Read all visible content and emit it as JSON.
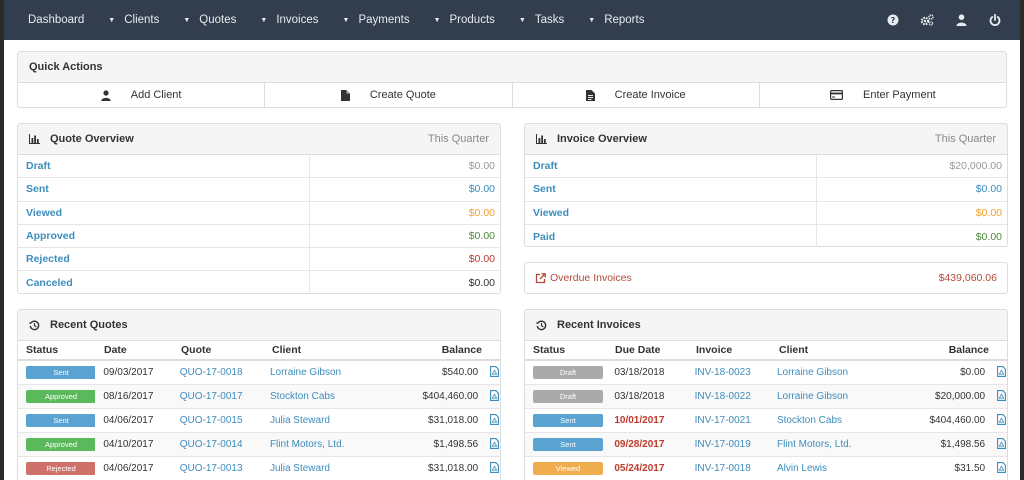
{
  "nav": {
    "items": [
      {
        "label": "Dashboard",
        "dropdown": false
      },
      {
        "label": "Clients",
        "dropdown": true
      },
      {
        "label": "Quotes",
        "dropdown": true
      },
      {
        "label": "Invoices",
        "dropdown": true
      },
      {
        "label": "Payments",
        "dropdown": true
      },
      {
        "label": "Products",
        "dropdown": true
      },
      {
        "label": "Tasks",
        "dropdown": true
      },
      {
        "label": "Reports",
        "dropdown": true
      }
    ],
    "right_icons": [
      "question-icon",
      "cogs-icon",
      "user-icon",
      "power-icon"
    ]
  },
  "quick_actions": {
    "title": "Quick Actions",
    "buttons": [
      {
        "label": "Add Client",
        "icon": "user-icon"
      },
      {
        "label": "Create Quote",
        "icon": "file-icon"
      },
      {
        "label": "Create Invoice",
        "icon": "file-text-icon"
      },
      {
        "label": "Enter Payment",
        "icon": "credit-card-icon"
      }
    ]
  },
  "quote_overview": {
    "title": "Quote Overview",
    "period": "This Quarter",
    "rows": [
      {
        "label": "Draft",
        "value": "$0.00",
        "color": "#999999"
      },
      {
        "label": "Sent",
        "value": "$0.00",
        "color": "#3c8dbc"
      },
      {
        "label": "Viewed",
        "value": "$0.00",
        "color": "#f0a030"
      },
      {
        "label": "Approved",
        "value": "$0.00",
        "color": "#4c8a3a"
      },
      {
        "label": "Rejected",
        "value": "$0.00",
        "color": "#c0392b"
      },
      {
        "label": "Canceled",
        "value": "$0.00",
        "color": "#333333"
      }
    ]
  },
  "invoice_overview": {
    "title": "Invoice Overview",
    "period": "This Quarter",
    "rows": [
      {
        "label": "Draft",
        "value": "$20,000.00",
        "color": "#999999"
      },
      {
        "label": "Sent",
        "value": "$0.00",
        "color": "#3c8dbc"
      },
      {
        "label": "Viewed",
        "value": "$0.00",
        "color": "#f0a030"
      },
      {
        "label": "Paid",
        "value": "$0.00",
        "color": "#4c8a3a"
      }
    ]
  },
  "overdue": {
    "label": "Overdue Invoices",
    "amount": "$439,060.06"
  },
  "recent_quotes": {
    "title": "Recent Quotes",
    "columns": [
      "Status",
      "Date",
      "Quote",
      "Client",
      "Balance"
    ],
    "rows": [
      {
        "status": "Sent",
        "date": "09/03/2017",
        "number": "QUO-17-0018",
        "client": "Lorraine Gibson",
        "balance": "$540.00"
      },
      {
        "status": "Approved",
        "date": "08/16/2017",
        "number": "QUO-17-0017",
        "client": "Stockton Cabs",
        "balance": "$404,460.00"
      },
      {
        "status": "Sent",
        "date": "04/06/2017",
        "number": "QUO-17-0015",
        "client": "Julia Steward",
        "balance": "$31,018.00"
      },
      {
        "status": "Approved",
        "date": "04/10/2017",
        "number": "QUO-17-0014",
        "client": "Flint Motors, Ltd.",
        "balance": "$1,498.56"
      },
      {
        "status": "Rejected",
        "date": "04/06/2017",
        "number": "QUO-17-0013",
        "client": "Julia Steward",
        "balance": "$31,018.00"
      }
    ]
  },
  "recent_invoices": {
    "title": "Recent Invoices",
    "columns": [
      "Status",
      "Due Date",
      "Invoice",
      "Client",
      "Balance"
    ],
    "rows": [
      {
        "status": "Draft",
        "date": "03/18/2018",
        "overdue": false,
        "number": "INV-18-0023",
        "client": "Lorraine Gibson",
        "balance": "$0.00"
      },
      {
        "status": "Draft",
        "date": "03/18/2018",
        "overdue": false,
        "number": "INV-18-0022",
        "client": "Lorraine Gibson",
        "balance": "$20,000.00"
      },
      {
        "status": "Sent",
        "date": "10/01/2017",
        "overdue": true,
        "number": "INV-17-0021",
        "client": "Stockton Cabs",
        "balance": "$404,460.00"
      },
      {
        "status": "Sent",
        "date": "09/28/2017",
        "overdue": true,
        "number": "INV-17-0019",
        "client": "Flint Motors, Ltd.",
        "balance": "$1,498.56"
      },
      {
        "status": "Viewed",
        "date": "05/24/2017",
        "overdue": true,
        "number": "INV-17-0018",
        "client": "Alvin Lewis",
        "balance": "$31.50"
      }
    ]
  }
}
